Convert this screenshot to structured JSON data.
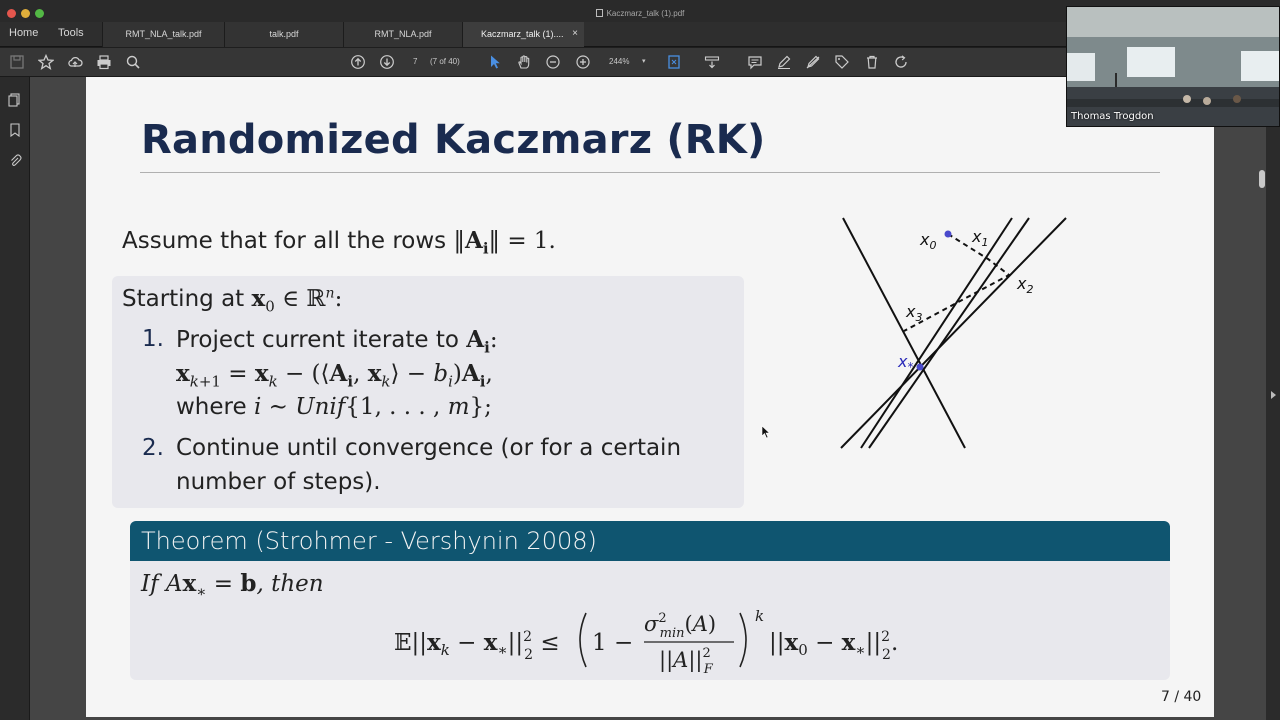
{
  "window": {
    "title": "Kaczmarz_talk (1).pdf"
  },
  "nav": {
    "home": "Home",
    "tools": "Tools"
  },
  "tabs": [
    {
      "label": "RMT_NLA_talk.pdf"
    },
    {
      "label": "talk.pdf"
    },
    {
      "label": "RMT_NLA.pdf"
    },
    {
      "label": "Kaczmarz_talk (1)....",
      "close": "×"
    }
  ],
  "toolbar": {
    "page_current": "7",
    "page_total": "(7 of 40)",
    "zoom": "244%"
  },
  "slide": {
    "title": "Randomized Kaczmarz (RK)",
    "assume_prefix": "Assume that for all the rows",
    "assume_suffix": "= 1.",
    "starting_prefix": "Starting at",
    "step1_num": "1.",
    "step1_text": "Project current iterate to",
    "step1_where": "where",
    "step2_num": "2.",
    "step2_line1": "Continue until convergence (or for a certain",
    "step2_line2": "number of steps).",
    "theorem_title": "Theorem (Strohmer - Vershynin 2008)",
    "theorem_if": "If",
    "theorem_then": ", then",
    "page_number": "7 / 40"
  },
  "diagram_labels": {
    "x0": "x",
    "x0_sub": "0",
    "x1": "x",
    "x1_sub": "1",
    "x2": "x",
    "x2_sub": "2",
    "x3": "x",
    "x3_sub": "3",
    "xstar": "x",
    "xstar_sub": "*"
  },
  "video": {
    "participant": "Thomas Trogdon"
  }
}
